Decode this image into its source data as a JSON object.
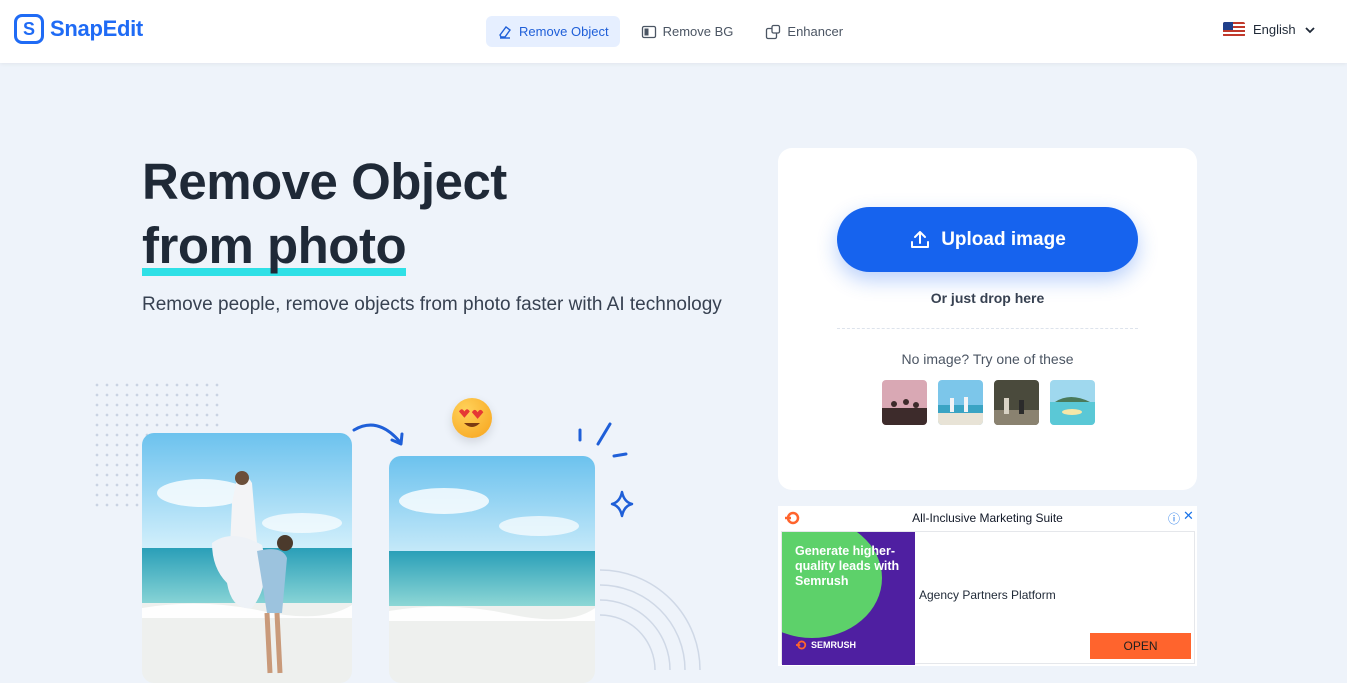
{
  "header": {
    "logo_text": "SnapEdit",
    "logo_icon": "snapedit-logo-icon",
    "nav": [
      {
        "label": "Remove Object",
        "icon": "eraser-icon",
        "active": true
      },
      {
        "label": "Remove BG",
        "icon": "remove-bg-icon",
        "active": false
      },
      {
        "label": "Enhancer",
        "icon": "enhancer-icon",
        "active": false
      }
    ],
    "language": {
      "label": "English",
      "icon": "us-flag-icon"
    }
  },
  "hero": {
    "title_line1": "Remove Object",
    "title_line2": "from photo",
    "subtitle": "Remove people, remove objects from photo faster with AI technology"
  },
  "upload": {
    "button_label": "Upload image",
    "drop_text": "Or just drop here",
    "try_text": "No image? Try one of these",
    "sample_count_note": "",
    "samples": [
      "sample-sunset-group",
      "sample-beach-people",
      "sample-street-scene",
      "sample-coastal-island"
    ]
  },
  "ad": {
    "headline": "All-Inclusive Marketing Suite",
    "image_text": "Generate higher-quality leads with Semrush",
    "brand": "SEMRUSH",
    "body_text": "Agency Partners Platform",
    "cta": "OPEN",
    "info_icon": "ⓘ",
    "close_icon": "✕"
  },
  "colors": {
    "brand_blue": "#1663ee",
    "highlight_cyan": "#2fe0e6",
    "ad_orange": "#ff642d",
    "ad_purple": "#4f1fa1",
    "ad_green": "#5dd16a"
  }
}
